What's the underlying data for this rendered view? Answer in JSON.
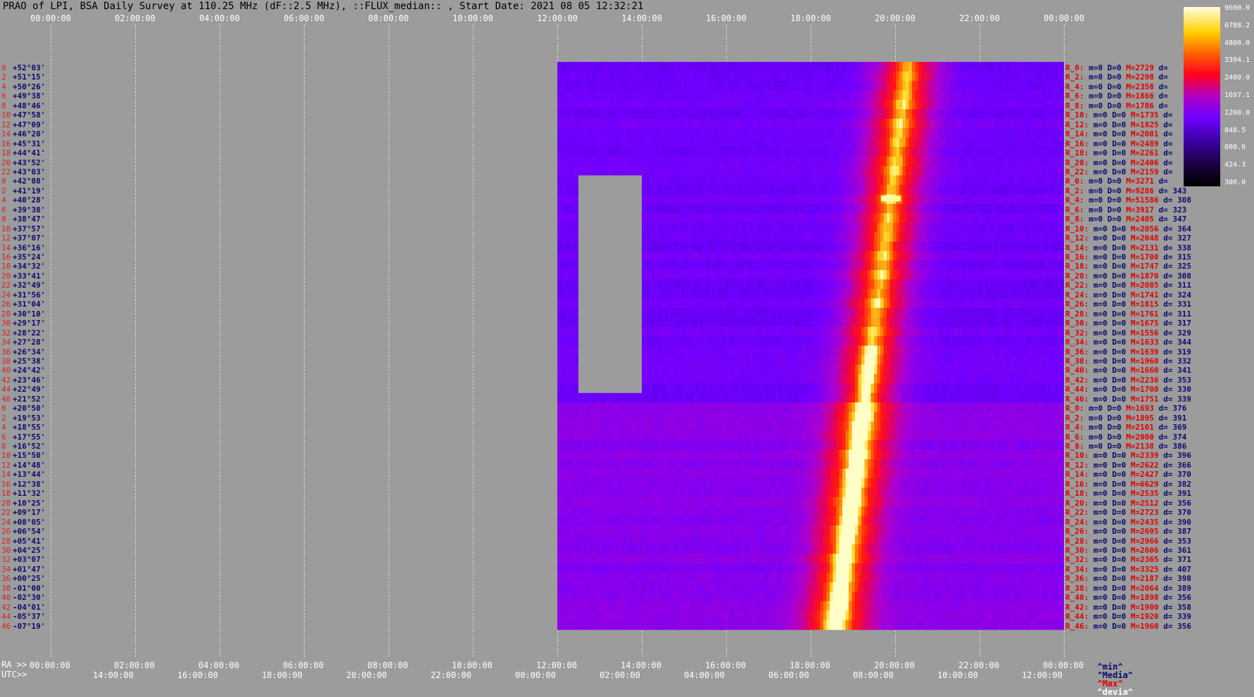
{
  "title": "PRAO of LPI, BSA Daily Survey at 110.25 MHz (dF::2.5 MHz), ::FLUX_median:: , Start Date: 2021 08 05 12:32:21",
  "top_ticks": [
    "00:00:00",
    "02:00:00",
    "04:00:00",
    "06:00:00",
    "08:00:00",
    "10:00:00",
    "12:00:00",
    "14:00:00",
    "16:00:00",
    "18:00:00",
    "20:00:00",
    "22:00:00",
    "00:00:00"
  ],
  "ra_label": "RA >>",
  "utc_label": "UTC>>",
  "ra_ticks": [
    "00:00:00",
    "02:00:00",
    "04:00:00",
    "06:00:00",
    "08:00:00",
    "10:00:00",
    "12:00:00",
    "14:00:00",
    "16:00:00",
    "18:00:00",
    "20:00:00",
    "22:00:00",
    "00:00:00"
  ],
  "utc_ticks": [
    "14:00:00",
    "16:00:00",
    "18:00:00",
    "20:00:00",
    "22:00:00",
    "00:00:00",
    "02:00:00",
    "04:00:00",
    "06:00:00",
    "08:00:00",
    "10:00:00",
    "12:00:00"
  ],
  "declinations": [
    "+52°03'",
    "+51°15'",
    "+50°26'",
    "+49°38'",
    "+48°46'",
    "+47°58'",
    "+47°09'",
    "+46°20'",
    "+45°31'",
    "+44°41'",
    "+43°52'",
    "+43°03'",
    "+42°08'",
    "+41°19'",
    "+40°28'",
    "+39°38'",
    "+38°47'",
    "+37°57'",
    "+37°07'",
    "+36°16'",
    "+35°24'",
    "+34°32'",
    "+33°41'",
    "+32°49'",
    "+31°56'",
    "+31°04'",
    "+30°10'",
    "+29°17'",
    "+28°22'",
    "+27°28'",
    "+26°34'",
    "+25°38'",
    "+24°42'",
    "+23°46'",
    "+22°49'",
    "+21°52'",
    "+20°50'",
    "+19°53'",
    "+18°55'",
    "+17°55'",
    "+16°52'",
    "+15°50'",
    "+14°48'",
    "+13°44'",
    "+12°38'",
    "+11°32'",
    "+10°25'",
    "+09°17'",
    "+08°05'",
    "+06°54'",
    "+05°41'",
    "+04°25'",
    "+03°07'",
    "+01°47'",
    "+00°25'",
    "-01°00'",
    "-02°30'",
    "-04°01'",
    "-05°37'",
    "-07°19'"
  ],
  "row_index": [
    "0",
    "2",
    "4",
    "6",
    "8",
    "10",
    "12",
    "14",
    "16",
    "18",
    "20",
    "22",
    "0",
    "2",
    "4",
    "6",
    "8",
    "10",
    "12",
    "14",
    "16",
    "18",
    "20",
    "22",
    "24",
    "26",
    "28",
    "30",
    "32",
    "34",
    "36",
    "38",
    "40",
    "42",
    "44",
    "46",
    "0",
    "2",
    "4",
    "6",
    "8",
    "10",
    "12",
    "14",
    "16",
    "18",
    "20",
    "22",
    "24",
    "26",
    "28",
    "30",
    "32",
    "34",
    "36",
    "38",
    "40",
    "42",
    "44",
    "46"
  ],
  "row_stats": [
    {
      "r": "R_0:",
      "m": "m=0",
      "D": "D=0",
      "M": "M=2729",
      "d": "d="
    },
    {
      "r": "R_2:",
      "m": "m=0",
      "D": "D=0",
      "M": "M=2298",
      "d": "d="
    },
    {
      "r": "R_4:",
      "m": "m=0",
      "D": "D=0",
      "M": "M=2358",
      "d": "d="
    },
    {
      "r": "R_6:",
      "m": "m=0",
      "D": "D=0",
      "M": "M=1866",
      "d": "d="
    },
    {
      "r": "R_8:",
      "m": "m=0",
      "D": "D=0",
      "M": "M=1786",
      "d": "d="
    },
    {
      "r": "R_10:",
      "m": "m=0",
      "D": "D=0",
      "M": "M=1735",
      "d": "d="
    },
    {
      "r": "R_12:",
      "m": "m=0",
      "D": "D=0",
      "M": "M=1825",
      "d": "d="
    },
    {
      "r": "R_14:",
      "m": "m=0",
      "D": "D=0",
      "M": "M=2001",
      "d": "d="
    },
    {
      "r": "R_16:",
      "m": "m=0",
      "D": "D=0",
      "M": "M=2489",
      "d": "d="
    },
    {
      "r": "R_18:",
      "m": "m=0",
      "D": "D=0",
      "M": "M=2261",
      "d": "d="
    },
    {
      "r": "R_20:",
      "m": "m=0",
      "D": "D=0",
      "M": "M=2406",
      "d": "d="
    },
    {
      "r": "R_22:",
      "m": "m=0",
      "D": "D=0",
      "M": "M=2159",
      "d": "d="
    },
    {
      "r": "R_0:",
      "m": "m=0",
      "D": "D=0",
      "M": "M=3271",
      "d": "d="
    },
    {
      "r": "R_2:",
      "m": "m=0",
      "D": "D=0",
      "M": "M=9286",
      "d": "d= 343"
    },
    {
      "r": "R_4:",
      "m": "m=0",
      "D": "D=0",
      "M": "M=51586",
      "d": "d= 308"
    },
    {
      "r": "R_6:",
      "m": "m=0",
      "D": "D=0",
      "M": "M=3917",
      "d": "d= 323"
    },
    {
      "r": "R_8:",
      "m": "m=0",
      "D": "D=0",
      "M": "M=2405",
      "d": "d= 347"
    },
    {
      "r": "R_10:",
      "m": "m=0",
      "D": "D=0",
      "M": "M=2056",
      "d": "d= 364"
    },
    {
      "r": "R_12:",
      "m": "m=0",
      "D": "D=0",
      "M": "M=2048",
      "d": "d= 327"
    },
    {
      "r": "R_14:",
      "m": "m=0",
      "D": "D=0",
      "M": "M=2131",
      "d": "d= 338"
    },
    {
      "r": "R_16:",
      "m": "m=0",
      "D": "D=0",
      "M": "M=1700",
      "d": "d= 315"
    },
    {
      "r": "R_18:",
      "m": "m=0",
      "D": "D=0",
      "M": "M=1747",
      "d": "d= 325"
    },
    {
      "r": "R_20:",
      "m": "m=0",
      "D": "D=0",
      "M": "M=1870",
      "d": "d= 308"
    },
    {
      "r": "R_22:",
      "m": "m=0",
      "D": "D=0",
      "M": "M=2085",
      "d": "d= 311"
    },
    {
      "r": "R_24:",
      "m": "m=0",
      "D": "D=0",
      "M": "M=1741",
      "d": "d= 324"
    },
    {
      "r": "R_26:",
      "m": "m=0",
      "D": "D=0",
      "M": "M=1815",
      "d": "d= 331"
    },
    {
      "r": "R_28:",
      "m": "m=0",
      "D": "D=0",
      "M": "M=1761",
      "d": "d= 311"
    },
    {
      "r": "R_30:",
      "m": "m=0",
      "D": "D=0",
      "M": "M=1675",
      "d": "d= 317"
    },
    {
      "r": "R_32:",
      "m": "m=0",
      "D": "D=0",
      "M": "M=1556",
      "d": "d= 329"
    },
    {
      "r": "R_34:",
      "m": "m=0",
      "D": "D=0",
      "M": "M=1633",
      "d": "d= 344"
    },
    {
      "r": "R_36:",
      "m": "m=0",
      "D": "D=0",
      "M": "M=1639",
      "d": "d= 319"
    },
    {
      "r": "R_38:",
      "m": "m=0",
      "D": "D=0",
      "M": "M=1960",
      "d": "d= 332"
    },
    {
      "r": "R_40:",
      "m": "m=0",
      "D": "D=0",
      "M": "M=1660",
      "d": "d= 341"
    },
    {
      "r": "R_42:",
      "m": "m=0",
      "D": "D=0",
      "M": "M=2236",
      "d": "d= 353"
    },
    {
      "r": "R_44:",
      "m": "m=0",
      "D": "D=0",
      "M": "M=1700",
      "d": "d= 330"
    },
    {
      "r": "R_46:",
      "m": "m=0",
      "D": "D=0",
      "M": "M=1751",
      "d": "d= 339"
    },
    {
      "r": "R_0:",
      "m": "m=0",
      "D": "D=0",
      "M": "M=1693",
      "d": "d= 376"
    },
    {
      "r": "R_2:",
      "m": "m=0",
      "D": "D=0",
      "M": "M=1895",
      "d": "d= 391"
    },
    {
      "r": "R_4:",
      "m": "m=0",
      "D": "D=0",
      "M": "M=2101",
      "d": "d= 369"
    },
    {
      "r": "R_6:",
      "m": "m=0",
      "D": "D=0",
      "M": "M=2000",
      "d": "d= 374"
    },
    {
      "r": "R_8:",
      "m": "m=0",
      "D": "D=0",
      "M": "M=2138",
      "d": "d= 386"
    },
    {
      "r": "R_10:",
      "m": "m=0",
      "D": "D=0",
      "M": "M=2339",
      "d": "d= 396"
    },
    {
      "r": "R_12:",
      "m": "m=0",
      "D": "D=0",
      "M": "M=2622",
      "d": "d= 366"
    },
    {
      "r": "R_14:",
      "m": "m=0",
      "D": "D=0",
      "M": "M=2427",
      "d": "d= 370"
    },
    {
      "r": "R_16:",
      "m": "m=0",
      "D": "D=0",
      "M": "M=6629",
      "d": "d= 382"
    },
    {
      "r": "R_18:",
      "m": "m=0",
      "D": "D=0",
      "M": "M=2535",
      "d": "d= 391"
    },
    {
      "r": "R_20:",
      "m": "m=0",
      "D": "D=0",
      "M": "M=2512",
      "d": "d= 356"
    },
    {
      "r": "R_22:",
      "m": "m=0",
      "D": "D=0",
      "M": "M=2723",
      "d": "d= 370"
    },
    {
      "r": "R_24:",
      "m": "m=0",
      "D": "D=0",
      "M": "M=2435",
      "d": "d= 390"
    },
    {
      "r": "R_26:",
      "m": "m=0",
      "D": "D=0",
      "M": "M=2695",
      "d": "d= 387"
    },
    {
      "r": "R_28:",
      "m": "m=0",
      "D": "D=0",
      "M": "M=2966",
      "d": "d= 353"
    },
    {
      "r": "R_30:",
      "m": "m=0",
      "D": "D=0",
      "M": "M=2606",
      "d": "d= 361"
    },
    {
      "r": "R_32:",
      "m": "m=0",
      "D": "D=0",
      "M": "M=2365",
      "d": "d= 371"
    },
    {
      "r": "R_34:",
      "m": "m=0",
      "D": "D=0",
      "M": "M=3325",
      "d": "d= 407"
    },
    {
      "r": "R_36:",
      "m": "m=0",
      "D": "D=0",
      "M": "M=2187",
      "d": "d= 398"
    },
    {
      "r": "R_38:",
      "m": "m=0",
      "D": "D=0",
      "M": "M=2064",
      "d": "d= 389"
    },
    {
      "r": "R_40:",
      "m": "m=0",
      "D": "D=0",
      "M": "M=1898",
      "d": "d= 356"
    },
    {
      "r": "R_42:",
      "m": "m=0",
      "D": "D=0",
      "M": "M=1900",
      "d": "d= 358"
    },
    {
      "r": "R_44:",
      "m": "m=0",
      "D": "D=0",
      "M": "M=1920",
      "d": "d= 339"
    },
    {
      "r": "R_46:",
      "m": "m=0",
      "D": "D=0",
      "M": "M=1960",
      "d": "d= 356"
    }
  ],
  "colorbar_labels": [
    "9600.0",
    "6788.2",
    "4800.0",
    "3394.1",
    "2400.0",
    "1697.1",
    "1200.0",
    "848.5",
    "600.0",
    "424.3",
    "300.0"
  ],
  "legend": {
    "min": "^min^",
    "median": "^Media^",
    "max": "^Max^",
    "dev": "^devia^"
  },
  "colors": {
    "background": "#9c9c9c",
    "low": "#000000",
    "mid_low": "#6a00ff",
    "mid": "#b000c8",
    "high": "#ff1010",
    "peak": "#ffffa0"
  },
  "chart_data": {
    "type": "heatmap",
    "title": "PRAO of LPI, BSA Daily Survey at 110.25 MHz (dF::2.5 MHz), ::FLUX_median:: , Start Date: 2021 08 05 12:32:21",
    "xlabel": "RA / UTC",
    "x_range_hours": [
      0,
      24
    ],
    "data_start_ra_hours": 12,
    "colorbar_range": [
      300,
      9600
    ],
    "colorbar_scale": "log",
    "gap_rows": [
      12,
      35
    ],
    "gap_ra_hours": [
      12.5,
      14.0
    ],
    "bright_feature": {
      "description_ra_hours_top": 20.3,
      "description_ra_hours_bottom": 18.6
    },
    "hot_spot": {
      "row": 14,
      "ra_hours": 19.9,
      "value": 51586
    },
    "grid": true
  }
}
